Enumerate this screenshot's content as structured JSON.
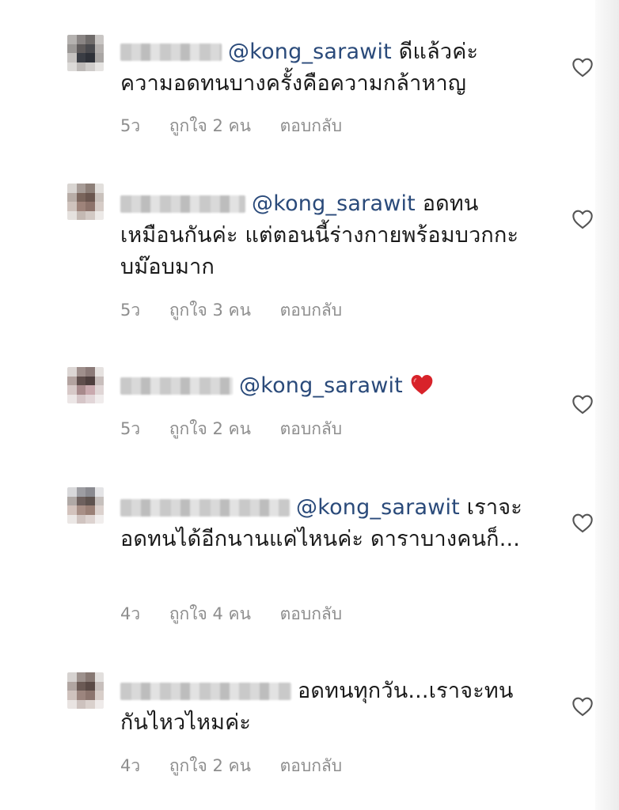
{
  "comments": [
    {
      "mention": "@kong_sarawit",
      "text": " ดีแล้วค่ะ ความอดทนบางครั้งคือความกล้าหาญ",
      "time": "5ว",
      "likes": "ถูกใจ 2 คน",
      "reply": "ตอบกลับ"
    },
    {
      "mention": "@kong_sarawit",
      "text": "  อดทนเหมือนกันค่ะ แต่ตอนนี้ร่างกายพร้อมบวกกะบม๊อบมาก",
      "time": "5ว",
      "likes": "ถูกใจ 3 คน",
      "reply": "ตอบกลับ"
    },
    {
      "mention": "@kong_sarawit",
      "text": "",
      "time": "5ว",
      "likes": "ถูกใจ 2 คน",
      "reply": "ตอบกลับ"
    },
    {
      "mention": "@kong_sarawit",
      "text": " เราจะอดทนได้อีกนานแค่ไหนค่ะ ดาราบางคนก็...",
      "time": "4ว",
      "likes": "ถูกใจ 4 คน",
      "reply": "ตอบกลับ"
    },
    {
      "mention": "",
      "text": "อดทนทุกวัน...เราจะทนกันไหวไหมค่ะ",
      "time": "4ว",
      "likes": "ถูกใจ 2 คน",
      "reply": "ตอบกลับ"
    }
  ],
  "icons": {
    "like": "heart-outline-icon",
    "emoji": "red-heart-emoji"
  },
  "colors": {
    "mention": "#2a4a7a",
    "meta": "#8e8e8e",
    "emoji_heart": "#d8232a"
  }
}
